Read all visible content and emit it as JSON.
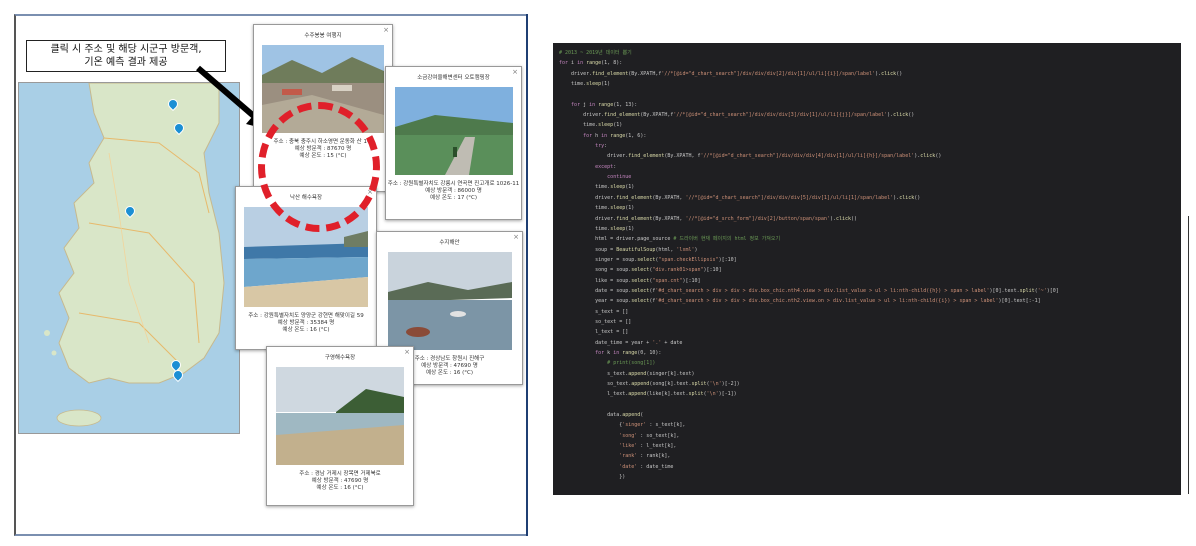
{
  "figure": {
    "callout_text_line1": "클릭 시 주소 및 해당 시군구 방문객,",
    "callout_text_line2": "기온 예측 결과 제공"
  },
  "popups": [
    {
      "title": "수주봉봉 여행지",
      "close": "×",
      "address": "주소 : 충북 충주시 하소영면 운동화 산 1-1",
      "visitors": "예상 방문객 : 87670 명",
      "temperature": "예상 온도 : 15 (°C)"
    },
    {
      "title": "소금강여울해변센터 오토캠핑장",
      "close": "×",
      "address": "주소 : 강원특별자치도 강릉시 연곡면 진고개로 1026-11",
      "visitors": "예상 방문객 : 86000 명",
      "temperature": "예상 온도 : 17 (°C)"
    },
    {
      "title": "낙산 해수욕장",
      "close": "×",
      "address": "주소 : 강원특별자치도 양양군 강현면 해맞이길 59",
      "visitors": "예상 방문객 : 35384 명",
      "temperature": "예상 온도 : 16 (°C)"
    },
    {
      "title": "수지해안",
      "close": "×",
      "address": "주소 : 경상남도 창원시 진해구",
      "visitors": "예상 방문객 : 47690 명",
      "temperature": "예상 온도 : 16 (°C)"
    },
    {
      "title": "구영해수욕장",
      "close": "×",
      "address": "주소 : 경남 거제시 장목면 거제북로",
      "visitors": "예상 방문객 : 47690 명",
      "temperature": "예상 온도 : 16 (°C)"
    }
  ],
  "code": {
    "lines": [
      "# 2013 ~ 2019년 데이터 뽑기",
      "for i in range(1, 8):",
      "    driver.find_element(By.XPATH,f'//*[@id=\"d_chart_search\"]/div/div/div[2]/div[1]/ul/li[{i}]/span/label').click()",
      "    time.sleep(1)",
      "",
      "    for j in range(1, 13):",
      "        driver.find_element(By.XPATH,f'//*[@id=\"d_chart_search\"]/div/div/div[3]/div[1]/ul/li[{j}]/span/label').click()",
      "        time.sleep(1)",
      "        for h in range(1, 6):",
      "            try:",
      "                driver.find_element(By.XPATH, f'//*[@id=\"d_chart_search\"]/div/div/div[4]/div[1]/ul/li[{h}]/span/label').click()",
      "            except:",
      "                continue",
      "            time.sleep(1)",
      "            driver.find_element(By.XPATH, '//*[@id=\"d_chart_search\"]/div/div/div[5]/div[1]/ul/li[1]/span/label').click()",
      "            time.sleep(1)",
      "            driver.find_element(By.XPATH, '//*[@id=\"d_srch_form\"]/div[2]/button/span/span').click()",
      "            time.sleep(1)",
      "            html = driver.page_source # 드라이버 현재 페이지의 html 정보 가져오기",
      "            soup = BeautifulSoup(html, 'lxml')",
      "            singer = soup.select(\"span.checkEllipsis\")[:10]",
      "            song = soup.select(\"div.rank01>span\")[:10]",
      "            like = soup.select(\"span.cnt\")[:10]",
      "            date = soup.select(f'#d_chart_search > div > div > div.box_chic.nth4.view > div.list_value > ul > li:nth-child({h}) > span > label')[0].text.split('~')[0]",
      "            year = soup.select(f'#d_chart_search > div > div > div.box_chic.nth2.view.on > div.list_value > ul > li:nth-child({i}) > span > label')[0].text[:-1]",
      "            s_text = []",
      "            so_text = []",
      "            l_text = []",
      "            date_time = year + '.' + date",
      "            for k in range(0, 10):",
      "                # print(song[1])",
      "                s_text.append(singer[k].text)",
      "                so_text.append(song[k].text.split('\\n')[-2])",
      "                l_text.append(like[k].text.split('\\n')[-1])",
      "",
      "                data.append(",
      "                    {'singer' : s_text[k],",
      "                    'song' : so_text[k],",
      "                    'like' : l_text[k],",
      "                    'rank' : rank[k],",
      "                    'date' : date_time",
      "                    })"
    ]
  },
  "colors": {
    "code_bg": "#1f1f22",
    "code_text": "#c8c8c8",
    "keyword": "#c586c0",
    "string": "#ce9178",
    "comment": "#6a9955",
    "function": "#dcdcaa",
    "dashed_circle": "#e0202a",
    "map_water": "#a9cfe6",
    "map_pin": "#1b8fd4"
  },
  "icons": {
    "popup_close": "close-icon",
    "map_pin": "map-pin-icon",
    "arrow": "arrow-icon"
  }
}
